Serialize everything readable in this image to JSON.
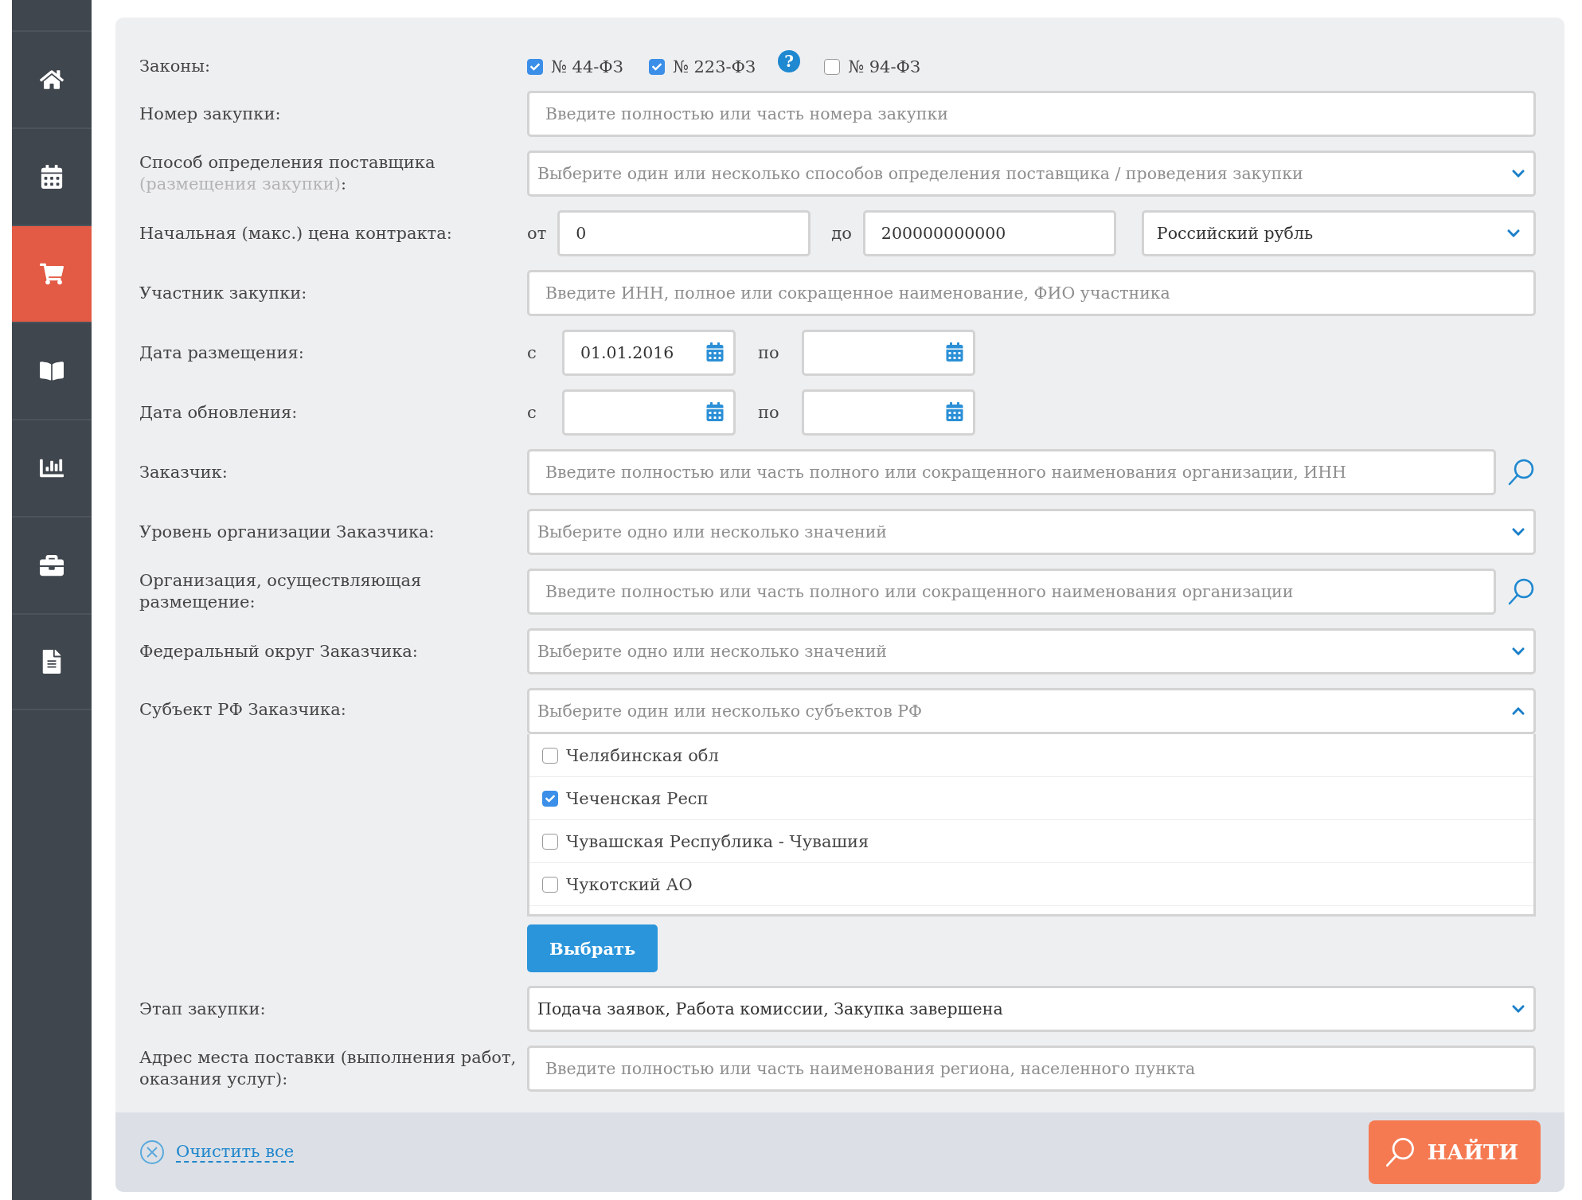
{
  "sidebar": {
    "items": [
      {
        "kind": "home",
        "selected": false
      },
      {
        "kind": "calendar",
        "selected": false
      },
      {
        "kind": "cart",
        "selected": true
      },
      {
        "kind": "book",
        "selected": false
      },
      {
        "kind": "report",
        "selected": false
      },
      {
        "kind": "briefcase",
        "selected": false
      },
      {
        "kind": "document",
        "selected": false
      }
    ]
  },
  "form": {
    "rows": [
      {
        "kind": "checkboxes",
        "label": "Законы:",
        "options": [
          {
            "label": "№ 44-ФЗ",
            "checked": true
          },
          {
            "label": "№ 223-ФЗ",
            "checked": true,
            "help": "?"
          },
          {
            "label": "№ 94-ФЗ",
            "checked": false
          }
        ]
      },
      {
        "kind": "text",
        "label": "Номер закупки:",
        "placeholder": "Введите полностью или часть номера закупки"
      },
      {
        "kind": "select",
        "label": "Способ определения поставщика",
        "label_note": "(размещения закупки)",
        "label_end": ":",
        "placeholder": "Выберите один или несколько способов определения поставщика / проведения закупки"
      },
      {
        "kind": "range",
        "label": "Начальная (макс.) цена контракта:",
        "from_label": "от",
        "from_value": "0",
        "to_label": "до",
        "to_value": "200000000000",
        "currency": "Российский рубль"
      },
      {
        "kind": "text",
        "label": "Участник закупки:",
        "placeholder": "Введите ИНН, полное или сокращенное наименование, ФИО участника"
      },
      {
        "kind": "dates",
        "label": "Дата размещения:",
        "from_label": "с",
        "from_value": "01.01.2016",
        "to_label": "по"
      },
      {
        "kind": "dates",
        "label": "Дата обновления:",
        "from_label": "с",
        "to_label": "по"
      },
      {
        "kind": "search",
        "label": "Заказчик:",
        "placeholder": "Введите полностью или часть полного или сокращенного наименования организации, ИНН"
      },
      {
        "kind": "select",
        "label": "Уровень организации Заказчика:",
        "placeholder": "Выберите одно или несколько значений"
      },
      {
        "kind": "search",
        "label": "Организация, осуществляющая размещение:",
        "placeholder": "Введите полностью или часть полного или сокращенного наименования организации"
      },
      {
        "kind": "select",
        "label": "Федеральный округ Заказчика:",
        "placeholder": "Выберите одно или несколько значений"
      },
      {
        "kind": "multiselect",
        "label": "Субъект РФ Заказчика:",
        "placeholder": "Выберите один или несколько субъектов РФ",
        "expanded": true,
        "options": [
          {
            "label": "Челябинская обл",
            "checked": false
          },
          {
            "label": "Чеченская Респ",
            "checked": true
          },
          {
            "label": "Чувашская Республика - Чувашия",
            "checked": false
          },
          {
            "label": "Чукотский АО",
            "checked": false
          }
        ],
        "button": "Выбрать"
      },
      {
        "kind": "select",
        "label": "Этап закупки:",
        "value": "Подача заявок, Работа комиссии, Закупка завершена"
      },
      {
        "kind": "text",
        "label": "Адрес места поставки (выполнения работ, оказания услуг):",
        "placeholder": "Введите полностью или часть наименования региона, населенного пункта"
      }
    ]
  },
  "footer": {
    "clear_link": "Очистить все",
    "search_button": "НАЙТИ"
  }
}
